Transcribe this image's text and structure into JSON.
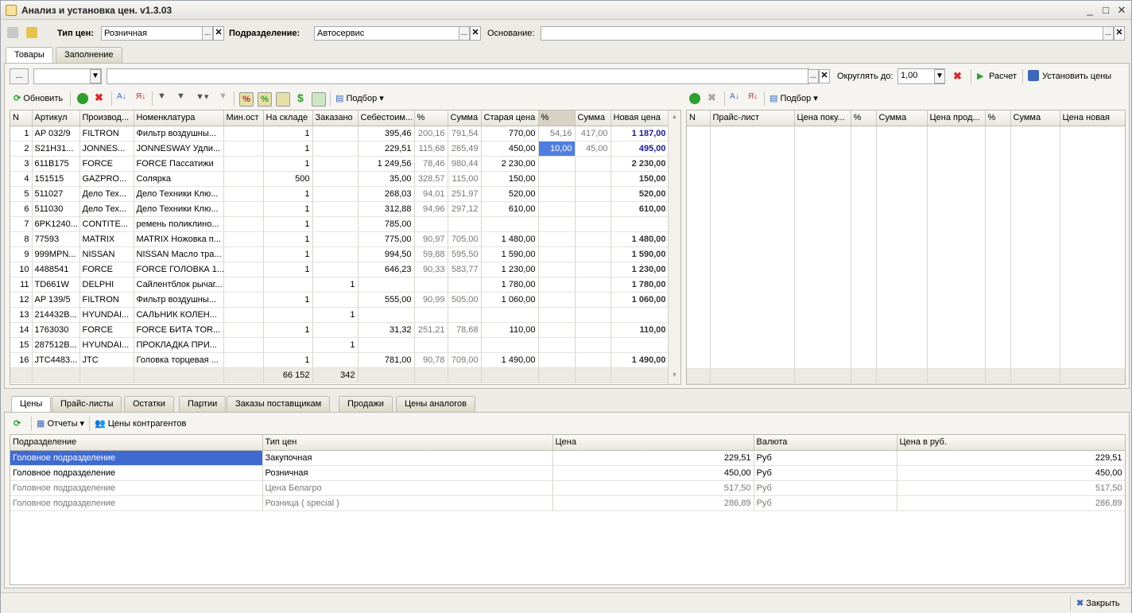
{
  "window": {
    "title": "Анализ и установка цен. v1.3.03",
    "min": "_",
    "max": "□",
    "close": "✕"
  },
  "header": {
    "price_type_label": "Тип цен:",
    "price_type_value": "Розничная",
    "division_label": "Подразделение:",
    "division_value": "Автосервис",
    "basis_label": "Основание:",
    "basis_value": ""
  },
  "tabs_top": [
    "Товары",
    "Заполнение"
  ],
  "filter": {
    "dots": "...",
    "round_label": "Округлять до:",
    "round_value": "1,00",
    "calc_label": "Расчет",
    "set_prices_label": "Установить цены"
  },
  "toolbar_left": {
    "refresh": "Обновить",
    "select": "Подбор"
  },
  "toolbar_right": {
    "select": "Подбор"
  },
  "goods": {
    "columns": [
      "N",
      "Артикул",
      "Производ...",
      "Номенклатура",
      "Мин.ост",
      "На складе",
      "Заказано",
      "Себестоим...",
      "%",
      "Сумма",
      "Старая цена",
      "%",
      "Сумма",
      "Новая цена"
    ],
    "rows": [
      [
        "1",
        "AP 032/9",
        "FILTRON",
        "Фильтр воздушны...",
        "",
        "1",
        "",
        "395,46",
        "200,16",
        "791,54",
        "770,00",
        "54,16",
        "417,00",
        "1 187,00"
      ],
      [
        "2",
        "S21H31...",
        "JONNES...",
        "JONNESWAY Удли...",
        "",
        "1",
        "",
        "229,51",
        "115,68",
        "265,49",
        "450,00",
        "10,00",
        "45,00",
        "495,00"
      ],
      [
        "3",
        "611B175",
        "FORCE",
        "FORCE Пассатижи",
        "",
        "1",
        "",
        "1 249,56",
        "78,46",
        "980,44",
        "2 230,00",
        "",
        "",
        "2 230,00"
      ],
      [
        "4",
        "151515",
        "GAZPRO...",
        "Солярка",
        "",
        "500",
        "",
        "35,00",
        "328,57",
        "115,00",
        "150,00",
        "",
        "",
        "150,00"
      ],
      [
        "5",
        "511027",
        "Дело Тех...",
        "Дело Техники Клю...",
        "",
        "1",
        "",
        "268,03",
        "94,01",
        "251,97",
        "520,00",
        "",
        "",
        "520,00"
      ],
      [
        "6",
        "511030",
        "Дело Тех...",
        "Дело Техники Клю...",
        "",
        "1",
        "",
        "312,88",
        "94,96",
        "297,12",
        "610,00",
        "",
        "",
        "610,00"
      ],
      [
        "7",
        "6PK1240...",
        "CONTITE...",
        "ремень поликлино...",
        "",
        "1",
        "",
        "785,00",
        "",
        "",
        "",
        "",
        "",
        ""
      ],
      [
        "8",
        "77593",
        "MATRIX",
        "MATRIX Ножовка п...",
        "",
        "1",
        "",
        "775,00",
        "90,97",
        "705,00",
        "1 480,00",
        "",
        "",
        "1 480,00"
      ],
      [
        "9",
        "999MPN...",
        "NISSAN",
        "NISSAN Масло тра...",
        "",
        "1",
        "",
        "994,50",
        "59,88",
        "595,50",
        "1 590,00",
        "",
        "",
        "1 590,00"
      ],
      [
        "10",
        "4488541",
        "FORCE",
        "FORCE ГОЛОВКА 1...",
        "",
        "1",
        "",
        "646,23",
        "90,33",
        "583,77",
        "1 230,00",
        "",
        "",
        "1 230,00"
      ],
      [
        "11",
        "TD661W",
        "DELPHI",
        "Сайлентблок рычаг...",
        "",
        "",
        "1",
        "",
        "",
        "",
        "1 780,00",
        "",
        "",
        "1 780,00"
      ],
      [
        "12",
        "AP 139/5",
        "FILTRON",
        "Фильтр воздушны...",
        "",
        "1",
        "",
        "555,00",
        "90,99",
        "505,00",
        "1 060,00",
        "",
        "",
        "1 060,00"
      ],
      [
        "13",
        "214432B...",
        "HYUNDAI...",
        "САЛЬНИК КОЛЕН...",
        "",
        "",
        "1",
        "",
        "",
        "",
        "",
        "",
        "",
        ""
      ],
      [
        "14",
        "1763030",
        "FORCE",
        "FORCE БИТА TOR...",
        "",
        "1",
        "",
        "31,32",
        "251,21",
        "78,68",
        "110,00",
        "",
        "",
        "110,00"
      ],
      [
        "15",
        "287512B...",
        "HYUNDAI...",
        "ПРОКЛАДКА ПРИ...",
        "",
        "",
        "1",
        "",
        "",
        "",
        "",
        "",
        "",
        ""
      ],
      [
        "16",
        "JTC4483...",
        "JTC",
        "Головка торцевая ...",
        "",
        "1",
        "",
        "781,00",
        "90,78",
        "709,00",
        "1 490,00",
        "",
        "",
        "1 490,00"
      ]
    ],
    "totals": {
      "stock": "66 152",
      "ordered": "342"
    }
  },
  "pricelists": {
    "columns": [
      "N",
      "Прайс-лист",
      "Цена поку...",
      "%",
      "Сумма",
      "Цена прод...",
      "%",
      "Сумма",
      "Цена новая"
    ]
  },
  "tabs_bottom": [
    "Цены",
    "Прайс-листы",
    "Остатки",
    "Партии",
    "Заказы поставщикам",
    "Продажи",
    "Цены аналогов"
  ],
  "bottom_toolbar": {
    "reports": "Отчеты",
    "counterparty_prices": "Цены контрагентов"
  },
  "prices": {
    "columns": [
      "Подразделение",
      "Тип цен",
      "Цена",
      "Валюта",
      "Цена в руб."
    ],
    "rows": [
      [
        "Головное подразделение",
        "Закупочная",
        "229,51",
        "Руб",
        "229,51"
      ],
      [
        "Головное подразделение",
        "Розничная",
        "450,00",
        "Руб",
        "450,00"
      ],
      [
        "Головное подразделение",
        "Цена Белагро",
        "517,50",
        "Руб",
        "517,50"
      ],
      [
        "Головное подразделение",
        "Розница ( special )",
        "286,89",
        "Руб",
        "286,89"
      ]
    ]
  },
  "close_label": "Закрыть",
  "colors": {
    "selection": "#3f6ad0",
    "new_price": "#1a1a8c",
    "green_icon": "#2e9e2e",
    "red_icon": "#d62828"
  }
}
